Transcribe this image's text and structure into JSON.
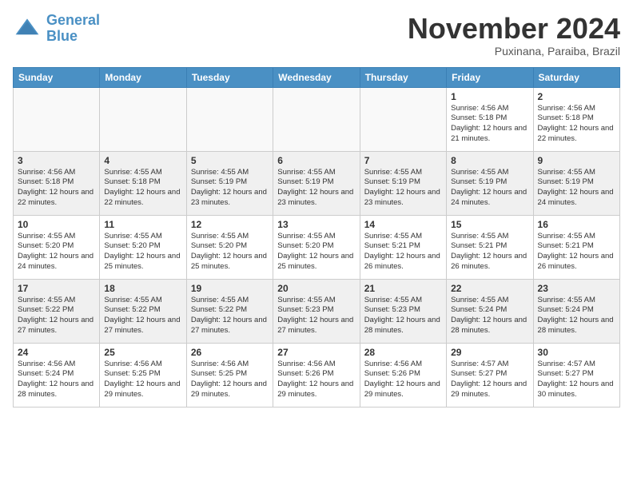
{
  "logo": {
    "line1": "General",
    "line2": "Blue"
  },
  "title": "November 2024",
  "location": "Puxinana, Paraiba, Brazil",
  "weekdays": [
    "Sunday",
    "Monday",
    "Tuesday",
    "Wednesday",
    "Thursday",
    "Friday",
    "Saturday"
  ],
  "weeks": [
    [
      {
        "day": "",
        "info": ""
      },
      {
        "day": "",
        "info": ""
      },
      {
        "day": "",
        "info": ""
      },
      {
        "day": "",
        "info": ""
      },
      {
        "day": "",
        "info": ""
      },
      {
        "day": "1",
        "info": "Sunrise: 4:56 AM\nSunset: 5:18 PM\nDaylight: 12 hours\nand 21 minutes."
      },
      {
        "day": "2",
        "info": "Sunrise: 4:56 AM\nSunset: 5:18 PM\nDaylight: 12 hours\nand 22 minutes."
      }
    ],
    [
      {
        "day": "3",
        "info": "Sunrise: 4:56 AM\nSunset: 5:18 PM\nDaylight: 12 hours\nand 22 minutes."
      },
      {
        "day": "4",
        "info": "Sunrise: 4:55 AM\nSunset: 5:18 PM\nDaylight: 12 hours\nand 22 minutes."
      },
      {
        "day": "5",
        "info": "Sunrise: 4:55 AM\nSunset: 5:19 PM\nDaylight: 12 hours\nand 23 minutes."
      },
      {
        "day": "6",
        "info": "Sunrise: 4:55 AM\nSunset: 5:19 PM\nDaylight: 12 hours\nand 23 minutes."
      },
      {
        "day": "7",
        "info": "Sunrise: 4:55 AM\nSunset: 5:19 PM\nDaylight: 12 hours\nand 23 minutes."
      },
      {
        "day": "8",
        "info": "Sunrise: 4:55 AM\nSunset: 5:19 PM\nDaylight: 12 hours\nand 24 minutes."
      },
      {
        "day": "9",
        "info": "Sunrise: 4:55 AM\nSunset: 5:19 PM\nDaylight: 12 hours\nand 24 minutes."
      }
    ],
    [
      {
        "day": "10",
        "info": "Sunrise: 4:55 AM\nSunset: 5:20 PM\nDaylight: 12 hours\nand 24 minutes."
      },
      {
        "day": "11",
        "info": "Sunrise: 4:55 AM\nSunset: 5:20 PM\nDaylight: 12 hours\nand 25 minutes."
      },
      {
        "day": "12",
        "info": "Sunrise: 4:55 AM\nSunset: 5:20 PM\nDaylight: 12 hours\nand 25 minutes."
      },
      {
        "day": "13",
        "info": "Sunrise: 4:55 AM\nSunset: 5:20 PM\nDaylight: 12 hours\nand 25 minutes."
      },
      {
        "day": "14",
        "info": "Sunrise: 4:55 AM\nSunset: 5:21 PM\nDaylight: 12 hours\nand 26 minutes."
      },
      {
        "day": "15",
        "info": "Sunrise: 4:55 AM\nSunset: 5:21 PM\nDaylight: 12 hours\nand 26 minutes."
      },
      {
        "day": "16",
        "info": "Sunrise: 4:55 AM\nSunset: 5:21 PM\nDaylight: 12 hours\nand 26 minutes."
      }
    ],
    [
      {
        "day": "17",
        "info": "Sunrise: 4:55 AM\nSunset: 5:22 PM\nDaylight: 12 hours\nand 27 minutes."
      },
      {
        "day": "18",
        "info": "Sunrise: 4:55 AM\nSunset: 5:22 PM\nDaylight: 12 hours\nand 27 minutes."
      },
      {
        "day": "19",
        "info": "Sunrise: 4:55 AM\nSunset: 5:22 PM\nDaylight: 12 hours\nand 27 minutes."
      },
      {
        "day": "20",
        "info": "Sunrise: 4:55 AM\nSunset: 5:23 PM\nDaylight: 12 hours\nand 27 minutes."
      },
      {
        "day": "21",
        "info": "Sunrise: 4:55 AM\nSunset: 5:23 PM\nDaylight: 12 hours\nand 28 minutes."
      },
      {
        "day": "22",
        "info": "Sunrise: 4:55 AM\nSunset: 5:24 PM\nDaylight: 12 hours\nand 28 minutes."
      },
      {
        "day": "23",
        "info": "Sunrise: 4:55 AM\nSunset: 5:24 PM\nDaylight: 12 hours\nand 28 minutes."
      }
    ],
    [
      {
        "day": "24",
        "info": "Sunrise: 4:56 AM\nSunset: 5:24 PM\nDaylight: 12 hours\nand 28 minutes."
      },
      {
        "day": "25",
        "info": "Sunrise: 4:56 AM\nSunset: 5:25 PM\nDaylight: 12 hours\nand 29 minutes."
      },
      {
        "day": "26",
        "info": "Sunrise: 4:56 AM\nSunset: 5:25 PM\nDaylight: 12 hours\nand 29 minutes."
      },
      {
        "day": "27",
        "info": "Sunrise: 4:56 AM\nSunset: 5:26 PM\nDaylight: 12 hours\nand 29 minutes."
      },
      {
        "day": "28",
        "info": "Sunrise: 4:56 AM\nSunset: 5:26 PM\nDaylight: 12 hours\nand 29 minutes."
      },
      {
        "day": "29",
        "info": "Sunrise: 4:57 AM\nSunset: 5:27 PM\nDaylight: 12 hours\nand 29 minutes."
      },
      {
        "day": "30",
        "info": "Sunrise: 4:57 AM\nSunset: 5:27 PM\nDaylight: 12 hours\nand 30 minutes."
      }
    ]
  ]
}
